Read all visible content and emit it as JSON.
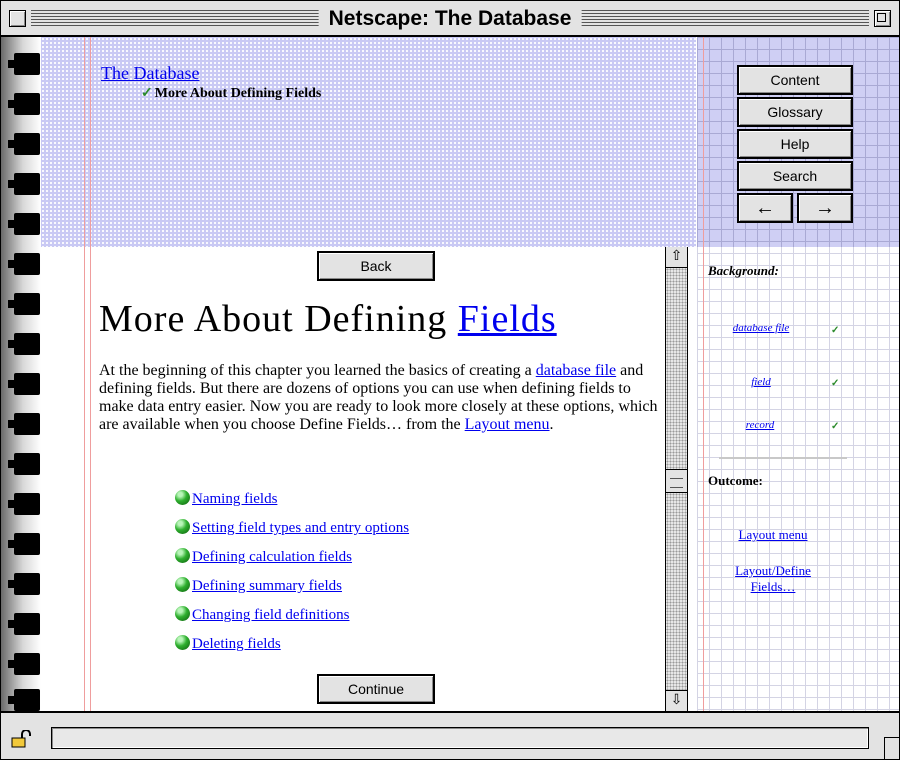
{
  "window": {
    "title": "Netscape: The Database"
  },
  "breadcrumb": {
    "parent": "The Database",
    "current": "More About Defining Fields"
  },
  "nav_buttons": {
    "content": "Content",
    "glossary": "Glossary",
    "help": "Help",
    "search": "Search",
    "back_arrow": "←",
    "forward_arrow": "→"
  },
  "main": {
    "back_label": "Back",
    "heading_text": "More About Defining ",
    "heading_link": "Fields",
    "paragraph": {
      "part1": "At the beginning of this chapter you learned the basics of creating a ",
      "link1": "database file",
      "part2": " and defining fields. But there are dozens of options you can use when defining fields to make data entry easier. Now you are ready to look more closely at these options, which are available when you choose Define Fields… from the ",
      "link2": "Layout menu",
      "part3": "."
    },
    "topics": [
      "Naming fields",
      "Setting field types and entry options",
      "Defining calculation fields",
      "Defining summary fields",
      "Changing field definitions",
      "Deleting fields"
    ],
    "continue_label": "Continue"
  },
  "sidebar": {
    "background_heading": "Background:",
    "background_terms": [
      "database file",
      "field",
      "record"
    ],
    "check_mark": "✓",
    "outcome_heading": "Outcome:",
    "outcome_links": [
      "Layout menu",
      "Layout/Define Fields…"
    ]
  },
  "statusbar": {
    "text": ""
  },
  "colors": {
    "link": "#0000ee",
    "top_band": "#c9c9f4",
    "margin_line": "#ef9d9d",
    "chrome": "#e3e3e3"
  }
}
